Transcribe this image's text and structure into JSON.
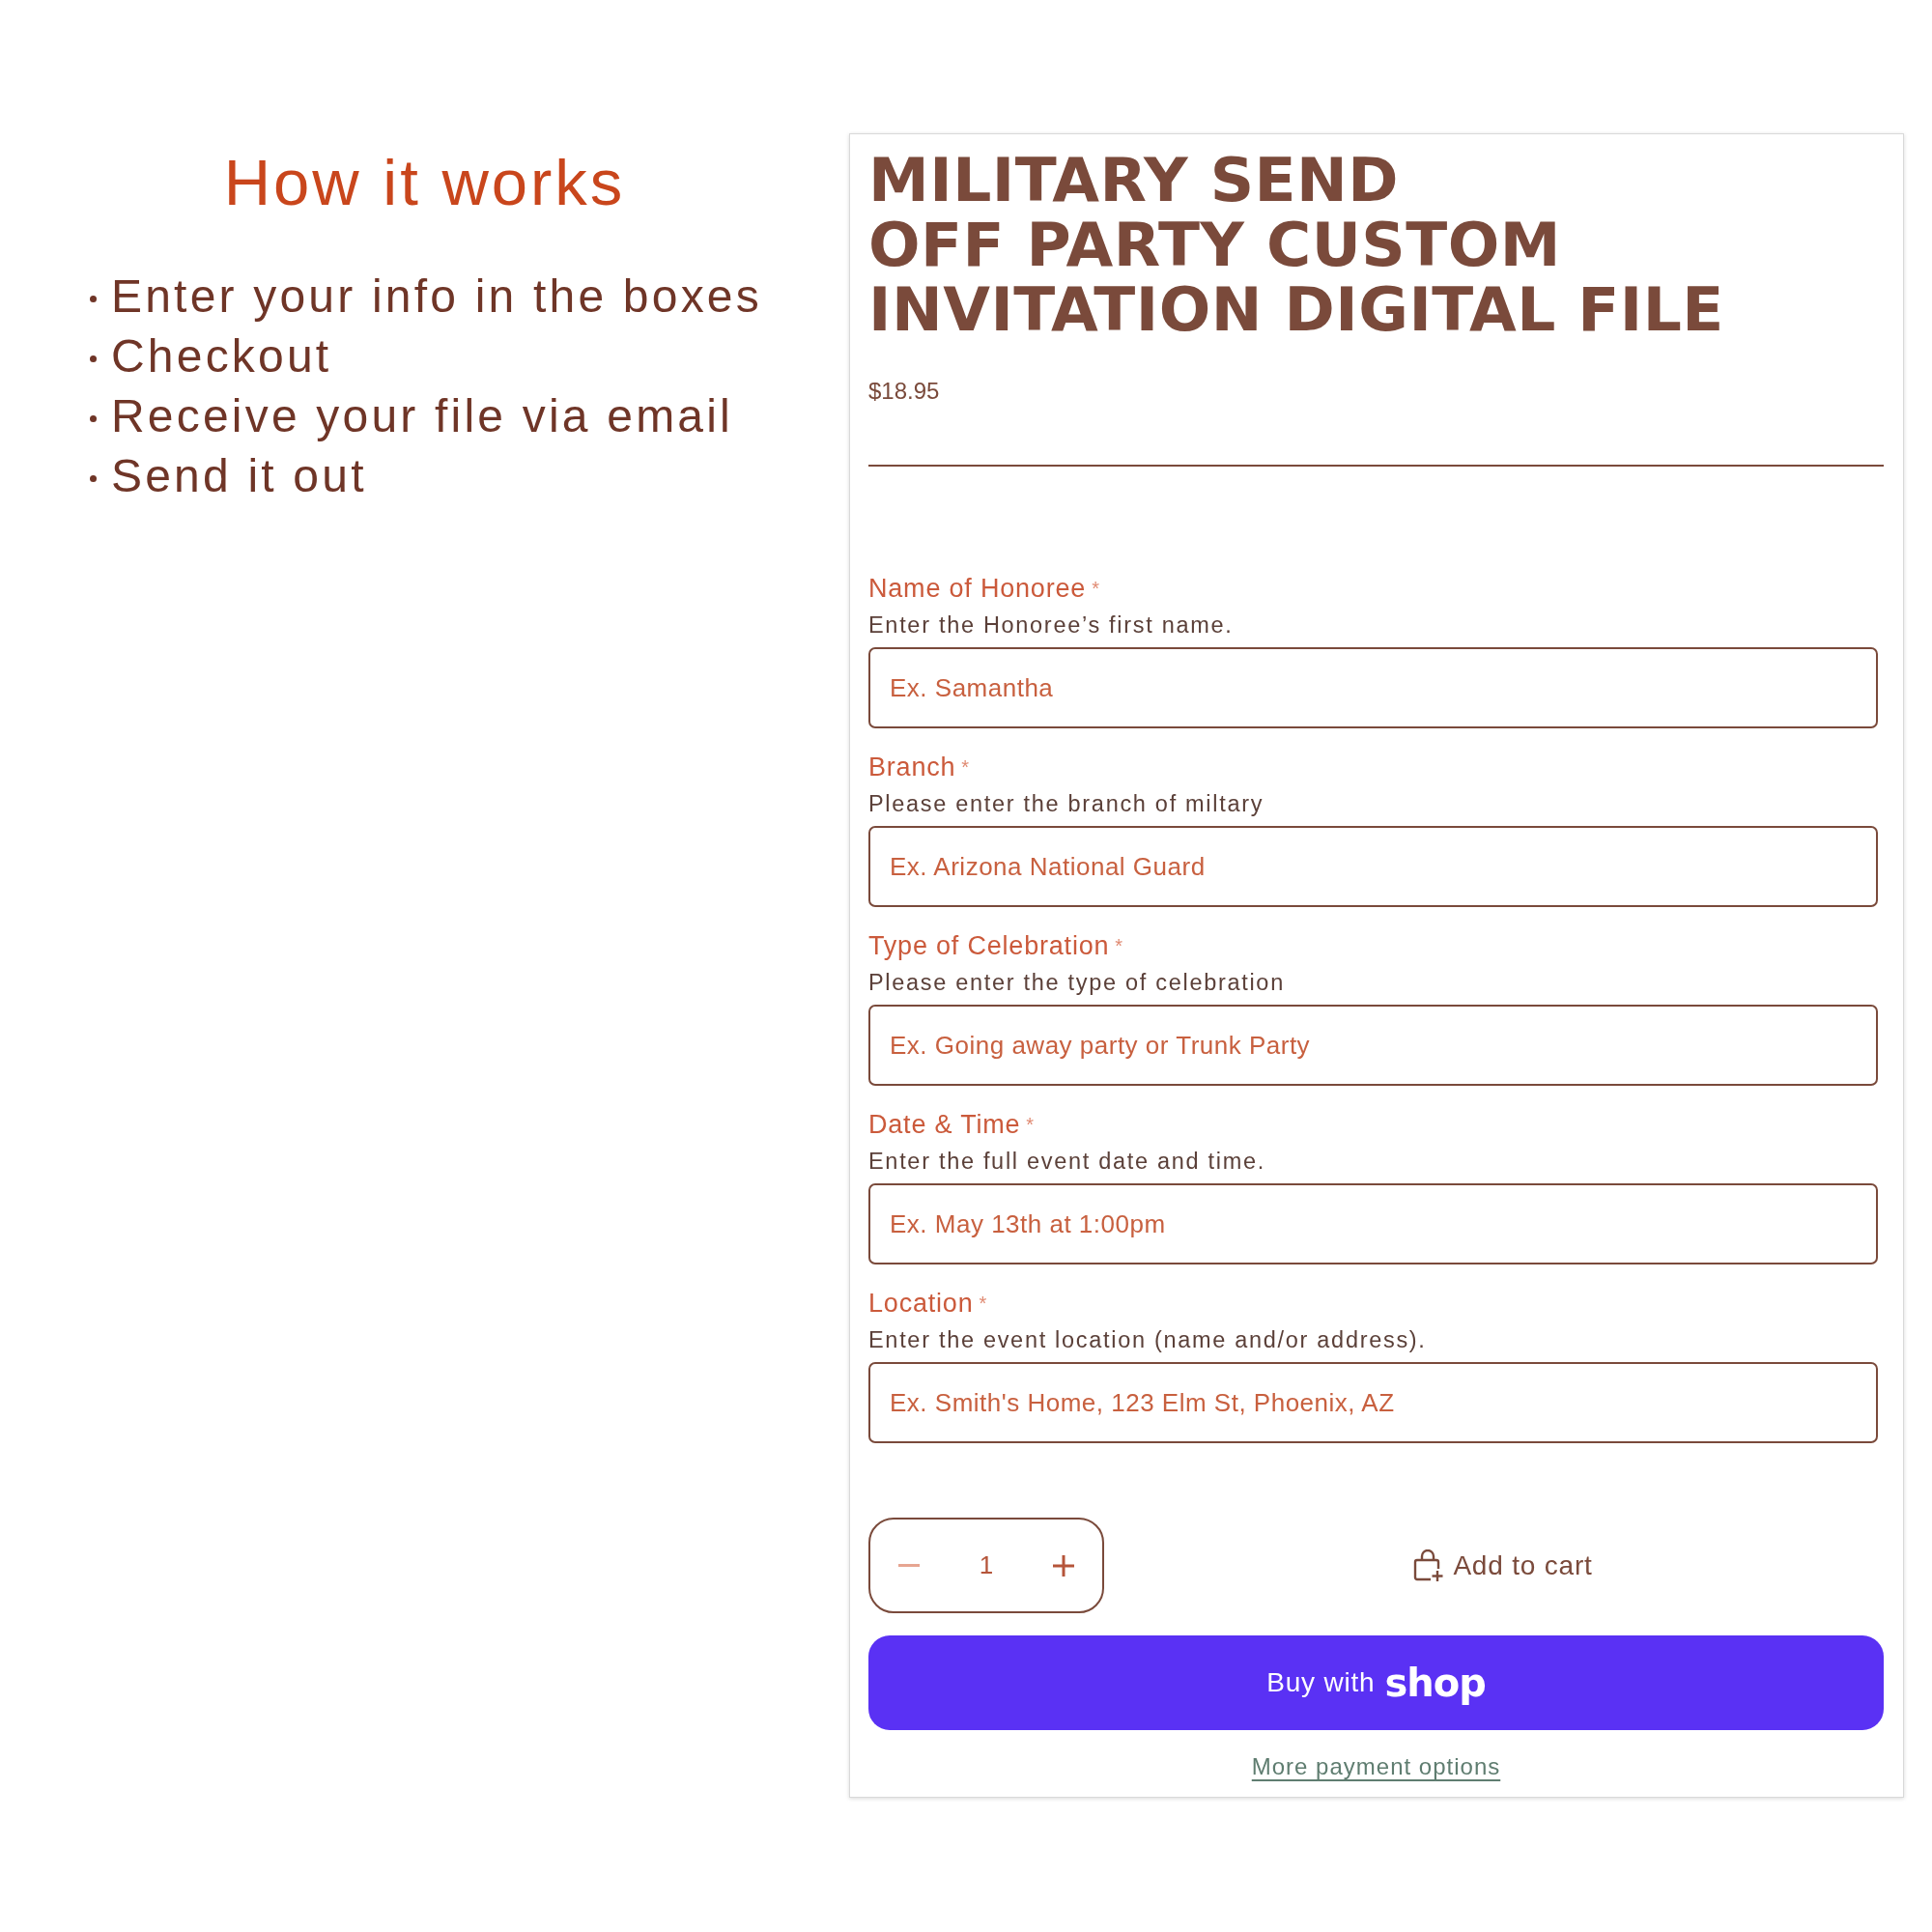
{
  "how_it_works": {
    "heading": "How it works",
    "steps": [
      "Enter your info in the boxes",
      "Checkout",
      "Receive your file via email",
      "Send it out"
    ]
  },
  "product": {
    "title_lines": [
      "MILITARY SEND",
      "OFF PARTY CUSTOM",
      "INVITATION DIGITAL FILE"
    ],
    "price": "$18.95",
    "fields": [
      {
        "label": "Name of Honoree",
        "required_mark": "*",
        "help": "Enter the Honoree’s first name.",
        "placeholder": "Ex. Samantha"
      },
      {
        "label": "Branch",
        "required_mark": "*",
        "help": "Please enter the branch of miltary",
        "placeholder": "Ex. Arizona National Guard"
      },
      {
        "label": "Type of Celebration",
        "required_mark": "*",
        "help": "Please enter the type of celebration",
        "placeholder": "Ex. Going away party or Trunk Party"
      },
      {
        "label": "Date & Time",
        "required_mark": "*",
        "help": "Enter the full event date and time.",
        "placeholder": "Ex. May 13th at 1:00pm"
      },
      {
        "label": "Location",
        "required_mark": "*",
        "help": "Enter the event location (name and/or address).",
        "placeholder": "Ex. Smith's Home, 123 Elm St, Phoenix, AZ"
      }
    ],
    "quantity": {
      "value": "1",
      "decrease_disabled": true
    },
    "add_to_cart": "Add to cart",
    "buy_button": "Buy with **shop**",
    "more_payment_options": "More payment options"
  }
}
